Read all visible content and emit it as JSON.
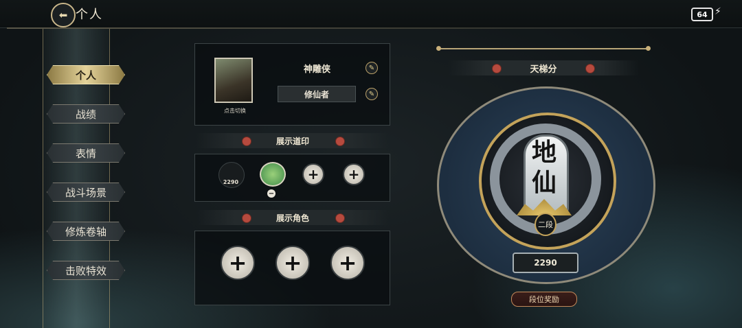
{
  "header": {
    "title": "个人",
    "back_icon": "back-arrow-icon"
  },
  "status": {
    "battery": "64",
    "charging": true
  },
  "sidebar": {
    "items": [
      {
        "label": "个人",
        "active": true
      },
      {
        "label": "战绩",
        "active": false
      },
      {
        "label": "表情",
        "active": false
      },
      {
        "label": "战斗场景",
        "active": false
      },
      {
        "label": "修炼卷轴",
        "active": false
      },
      {
        "label": "击败特效",
        "active": false
      }
    ]
  },
  "profile": {
    "avatar_label": "点击切换",
    "name": "神雕侠",
    "title": "修仙者"
  },
  "stamps": {
    "heading": "展示道印",
    "items": [
      {
        "type": "coil",
        "value": "2290"
      },
      {
        "type": "frog"
      },
      {
        "type": "empty"
      },
      {
        "type": "empty"
      }
    ]
  },
  "characters": {
    "heading": "展示角色",
    "slots": 3
  },
  "ladder": {
    "heading": "天梯分",
    "rank_name": "地仙",
    "rank_tier": "二段",
    "score": "2290",
    "reward_label": "段位奖励"
  },
  "colors": {
    "accent_gold": "#c4a35a",
    "rank_blue": "#2c4258"
  }
}
